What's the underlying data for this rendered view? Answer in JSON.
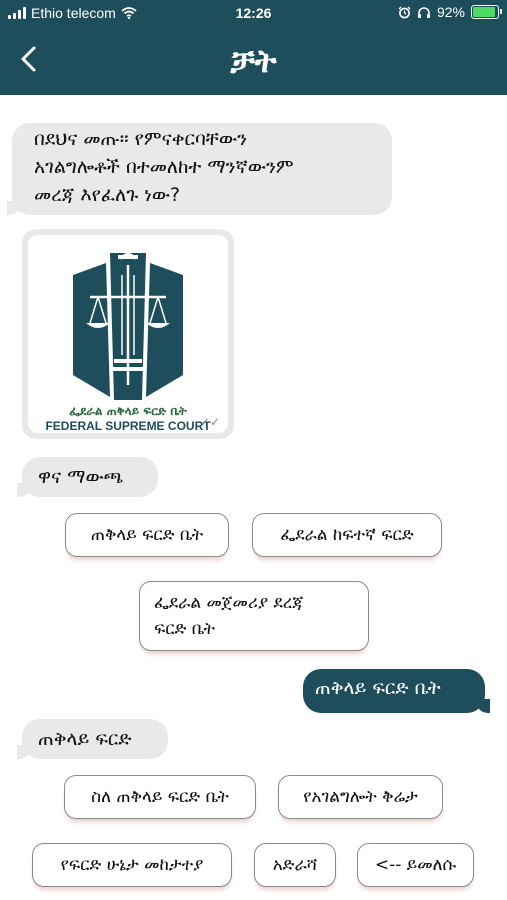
{
  "status": {
    "carrier": "Ethio telecom",
    "time": "12:26",
    "battery": "92%"
  },
  "header": {
    "title": "ቻት"
  },
  "messages": {
    "m1": [
      "በደህና መጡ። የምናቀርባቸውን",
      "አገልግሎቶች በተመለከተ ማንኛውንም",
      "መረጃ እየፈለጉ ነው?"
    ],
    "logo": {
      "amharic": "ፌደራል ጠቅላይ ፍርድ ቤት",
      "english": "FEDERAL SUPREME COURT"
    },
    "m2": "ዋና ማውጫ",
    "user": "ጠቅላይ ፍርድ ቤት",
    "m3": "ጠቅላይ ፍርድ"
  },
  "quick_replies_1": [
    "ጠቅላይ ፍርድ ቤት",
    "ፌደራል ከፍተኛ ፍርድ",
    [
      "ፌደራል መጀመሪያ ደረጃ",
      "ፍርድ ቤት"
    ]
  ],
  "quick_replies_2": [
    "ስለ ጠቅላይ ፍርድ ቤት",
    "የአገልግሎት ቅሬታ",
    "የፍርድ ሁኔታ መከታተያ",
    "አድራሻ",
    "<-- ይመለሱ"
  ],
  "colors": {
    "header_bg": "#1e4e5b",
    "incoming_bubble": "#e9e9eb",
    "outgoing_bubble": "#1e4e5b",
    "battery_fill": "#4cd964"
  },
  "battery_level": 0.92
}
